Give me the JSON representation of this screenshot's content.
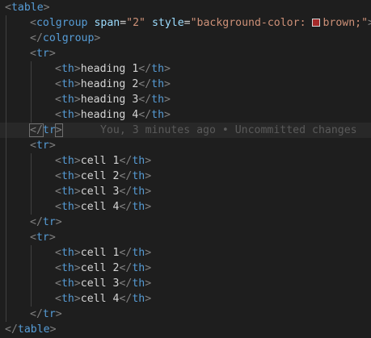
{
  "editor": {
    "colgroup": {
      "tag": "colgroup",
      "span_attr": "span",
      "span_value": "\"2\"",
      "style_attr": "style",
      "style_value_prefix": "\"background-color: ",
      "swatch_color": "#a52a2a",
      "style_value_suffix": "brown;\"",
      "close_tag": "colgroup"
    },
    "blame": "You, 3 minutes ago • Uncommitted changes",
    "lines": [
      {
        "kind": "open",
        "indent": 0,
        "tag": "table"
      },
      {
        "kind": "colgroup_open",
        "indent": 1
      },
      {
        "kind": "close",
        "indent": 1,
        "tag": "colgroup"
      },
      {
        "kind": "open",
        "indent": 1,
        "tag": "tr"
      },
      {
        "kind": "cell",
        "indent": 2,
        "tag": "th",
        "text": "heading 1"
      },
      {
        "kind": "cell",
        "indent": 2,
        "tag": "th",
        "text": "heading 2"
      },
      {
        "kind": "cell",
        "indent": 2,
        "tag": "th",
        "text": "heading 3"
      },
      {
        "kind": "cell",
        "indent": 2,
        "tag": "th",
        "text": "heading 4"
      },
      {
        "kind": "close",
        "indent": 1,
        "tag": "tr",
        "current": true
      },
      {
        "kind": "open",
        "indent": 1,
        "tag": "tr"
      },
      {
        "kind": "cell",
        "indent": 2,
        "tag": "th",
        "text": "cell 1"
      },
      {
        "kind": "cell",
        "indent": 2,
        "tag": "th",
        "text": "cell 2"
      },
      {
        "kind": "cell",
        "indent": 2,
        "tag": "th",
        "text": "cell 3"
      },
      {
        "kind": "cell",
        "indent": 2,
        "tag": "th",
        "text": "cell 4"
      },
      {
        "kind": "close",
        "indent": 1,
        "tag": "tr"
      },
      {
        "kind": "open",
        "indent": 1,
        "tag": "tr"
      },
      {
        "kind": "cell",
        "indent": 2,
        "tag": "th",
        "text": "cell 1"
      },
      {
        "kind": "cell",
        "indent": 2,
        "tag": "th",
        "text": "cell 2"
      },
      {
        "kind": "cell",
        "indent": 2,
        "tag": "th",
        "text": "cell 3"
      },
      {
        "kind": "cell",
        "indent": 2,
        "tag": "th",
        "text": "cell 4"
      },
      {
        "kind": "close",
        "indent": 1,
        "tag": "tr"
      },
      {
        "kind": "close",
        "indent": 0,
        "tag": "table"
      }
    ]
  }
}
